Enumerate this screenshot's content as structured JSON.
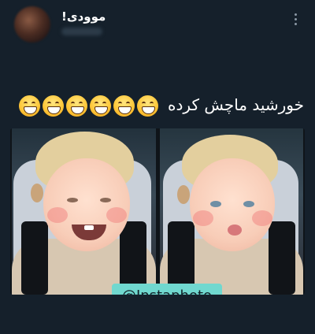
{
  "post": {
    "author_name": "موودی!",
    "text": "خورشید ماچش کرده",
    "emoji_count": 6,
    "emoji_name": "grinning-face-with-smiling-eyes",
    "watermark": "@Instaphoto"
  },
  "colors": {
    "background": "#15202b",
    "watermark_bg": "#70d8cf"
  },
  "icons": {
    "more": "more-vertical-icon"
  }
}
